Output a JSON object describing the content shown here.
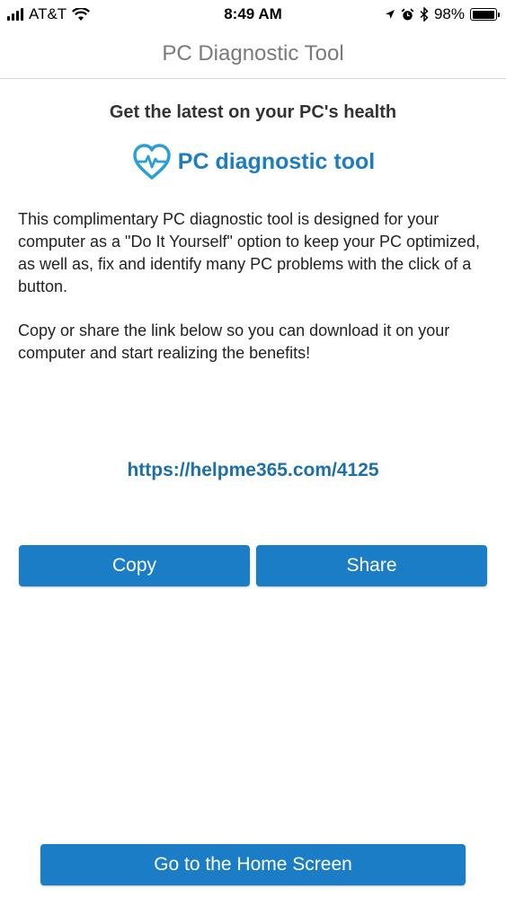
{
  "status_bar": {
    "carrier": "AT&T",
    "time": "8:49 AM",
    "battery_percent": "98%",
    "battery_level": 0.98,
    "icons": [
      "signal-icon",
      "wifi-icon",
      "location-icon",
      "alarm-icon",
      "bluetooth-icon",
      "battery-icon"
    ]
  },
  "nav": {
    "title": "PC Diagnostic Tool"
  },
  "content": {
    "headline": "Get the latest on your PC's health",
    "brand_name": "PC diagnostic tool",
    "paragraph_1": "This complimentary PC diagnostic tool is designed for your computer as a \"Do It Yourself\" option to keep your PC optimized, as well as, fix and identify many PC problems with the click of a button.",
    "paragraph_2": "Copy or share the link below so you can download it on your computer and start realizing the benefits!",
    "link": "https://helpme365.com/4125"
  },
  "buttons": {
    "copy": "Copy",
    "share": "Share",
    "home": "Go to the Home Screen"
  },
  "colors": {
    "accent": "#1a7dc6",
    "brand": "#1d7dc2",
    "link": "#1d6fa8"
  }
}
